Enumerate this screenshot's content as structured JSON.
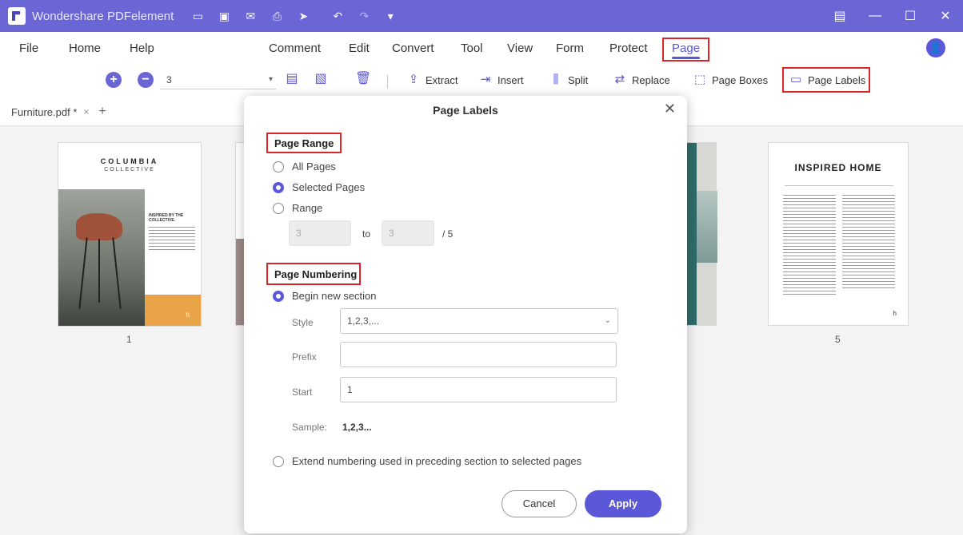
{
  "app": {
    "title": "Wondershare PDFelement"
  },
  "window_controls": {
    "minimize": "—",
    "maximize": "☐",
    "close": "✕"
  },
  "menu": {
    "items": [
      "File",
      "Home",
      "Help",
      "Comment",
      "Edit",
      "Convert",
      "Tool",
      "View",
      "Form",
      "Protect",
      "Page"
    ],
    "active": "Page"
  },
  "toolbar": {
    "page_value": "3",
    "extract": "Extract",
    "insert": "Insert",
    "split": "Split",
    "replace": "Replace",
    "page_boxes": "Page Boxes",
    "page_labels": "Page Labels"
  },
  "tabs": {
    "doc_name": "Furniture.pdf *",
    "close": "×",
    "add": "+"
  },
  "thumbnails": {
    "page1": {
      "number": "1",
      "title": "COLUMBIA",
      "subtitle": "COLLECTIVE",
      "heading": "INSPIRED BY THE COLLECTIVE.",
      "corner": "h"
    },
    "page5": {
      "number": "5",
      "title": "INSPIRED HOME",
      "corner": "h"
    }
  },
  "dialog": {
    "title": "Page Labels",
    "close": "✕",
    "page_range": {
      "label": "Page Range",
      "options": [
        "All Pages",
        "Selected Pages",
        "Range"
      ],
      "selected": "Selected Pages",
      "from": "3",
      "to_label": "to",
      "to": "3",
      "total": "/ 5"
    },
    "page_numbering": {
      "label": "Page Numbering",
      "begin_new_section": "Begin new section",
      "style_label": "Style",
      "style_value": "1,2,3,...",
      "prefix_label": "Prefix",
      "prefix_value": "",
      "start_label": "Start",
      "start_value": "1",
      "sample_label": "Sample:",
      "sample_value": "1,2,3...",
      "extend_option": "Extend numbering used in preceding section to selected pages"
    },
    "cancel": "Cancel",
    "apply": "Apply"
  },
  "colors": {
    "accent": "#5b57d9",
    "titlebar": "#6b66d6",
    "highlight": "#d8262b",
    "orange": "#e9a448"
  }
}
